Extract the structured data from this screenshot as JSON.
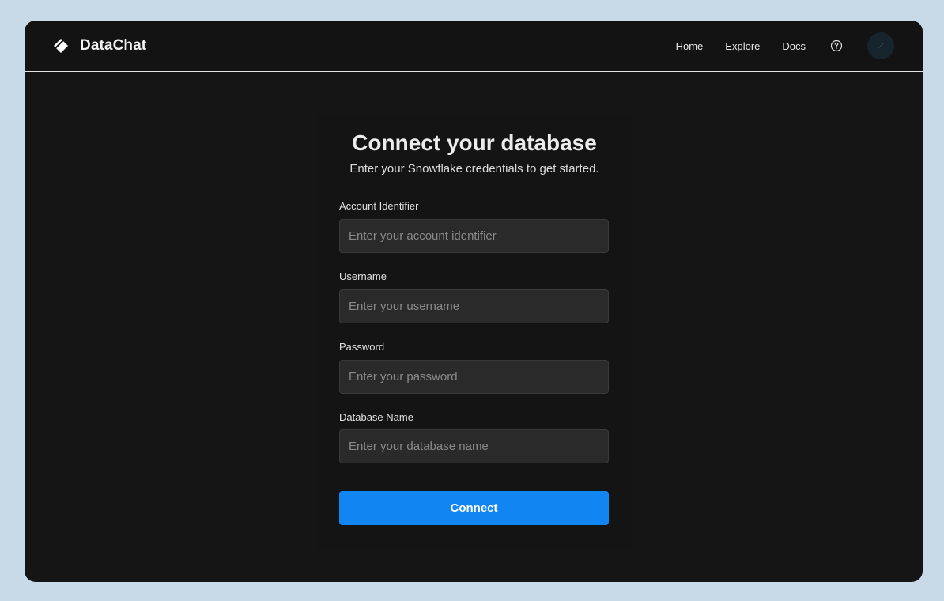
{
  "app": {
    "brand": "DataChat",
    "icons": {
      "logo": "diamond-logo-icon",
      "help": "question-circle-icon",
      "avatar": "user-avatar"
    }
  },
  "nav": {
    "home": "Home",
    "explore": "Explore",
    "docs": "Docs"
  },
  "form": {
    "title": "Connect your database",
    "subtitle": "Enter your Snowflake credentials to get started.",
    "fields": [
      {
        "label": "Account Identifier",
        "placeholder": "Enter your account identifier",
        "value": ""
      },
      {
        "label": "Username",
        "placeholder": "Enter your username",
        "value": ""
      },
      {
        "label": "Password",
        "placeholder": "Enter your password",
        "value": ""
      },
      {
        "label": "Database Name",
        "placeholder": "Enter your database name",
        "value": ""
      }
    ],
    "submit_label": "Connect"
  },
  "colors": {
    "page_background": "#c8d9e8",
    "window_background": "#151515",
    "accent": "#1185f2",
    "input_background": "#2a2a2a"
  }
}
